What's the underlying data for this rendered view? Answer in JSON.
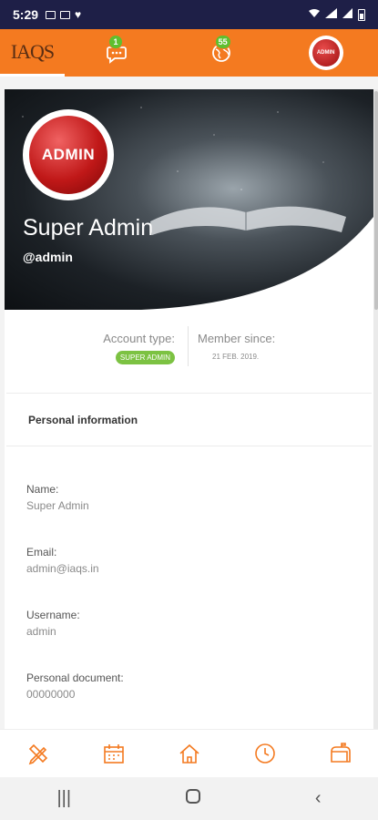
{
  "status_bar": {
    "time": "5:29"
  },
  "header": {
    "logo": "IAQS",
    "messages_badge": "1",
    "notifications_badge": "55",
    "avatar_text": "ADMIN"
  },
  "profile": {
    "avatar_text": "ADMIN",
    "name": "Super Admin",
    "handle": "@admin",
    "account_type_label": "Account type:",
    "account_type_value": "SUPER ADMIN",
    "member_since_label": "Member since:",
    "member_since_value": "21 FEB. 2019."
  },
  "personal_info": {
    "title": "Personal information",
    "fields": [
      {
        "label": "Name:",
        "value": "Super Admin"
      },
      {
        "label": "Email:",
        "value": "admin@iaqs.in"
      },
      {
        "label": "Username:",
        "value": "admin"
      },
      {
        "label": "Personal document:",
        "value": "00000000"
      }
    ]
  },
  "bottom_nav": {
    "icons": [
      "edit-pencil-ruler-icon",
      "calendar-icon",
      "home-icon",
      "clock-icon",
      "mailbox-icon"
    ]
  },
  "colors": {
    "accent": "#f47a20",
    "badge": "#5fbf2f",
    "status_bar": "#1e1f47"
  }
}
